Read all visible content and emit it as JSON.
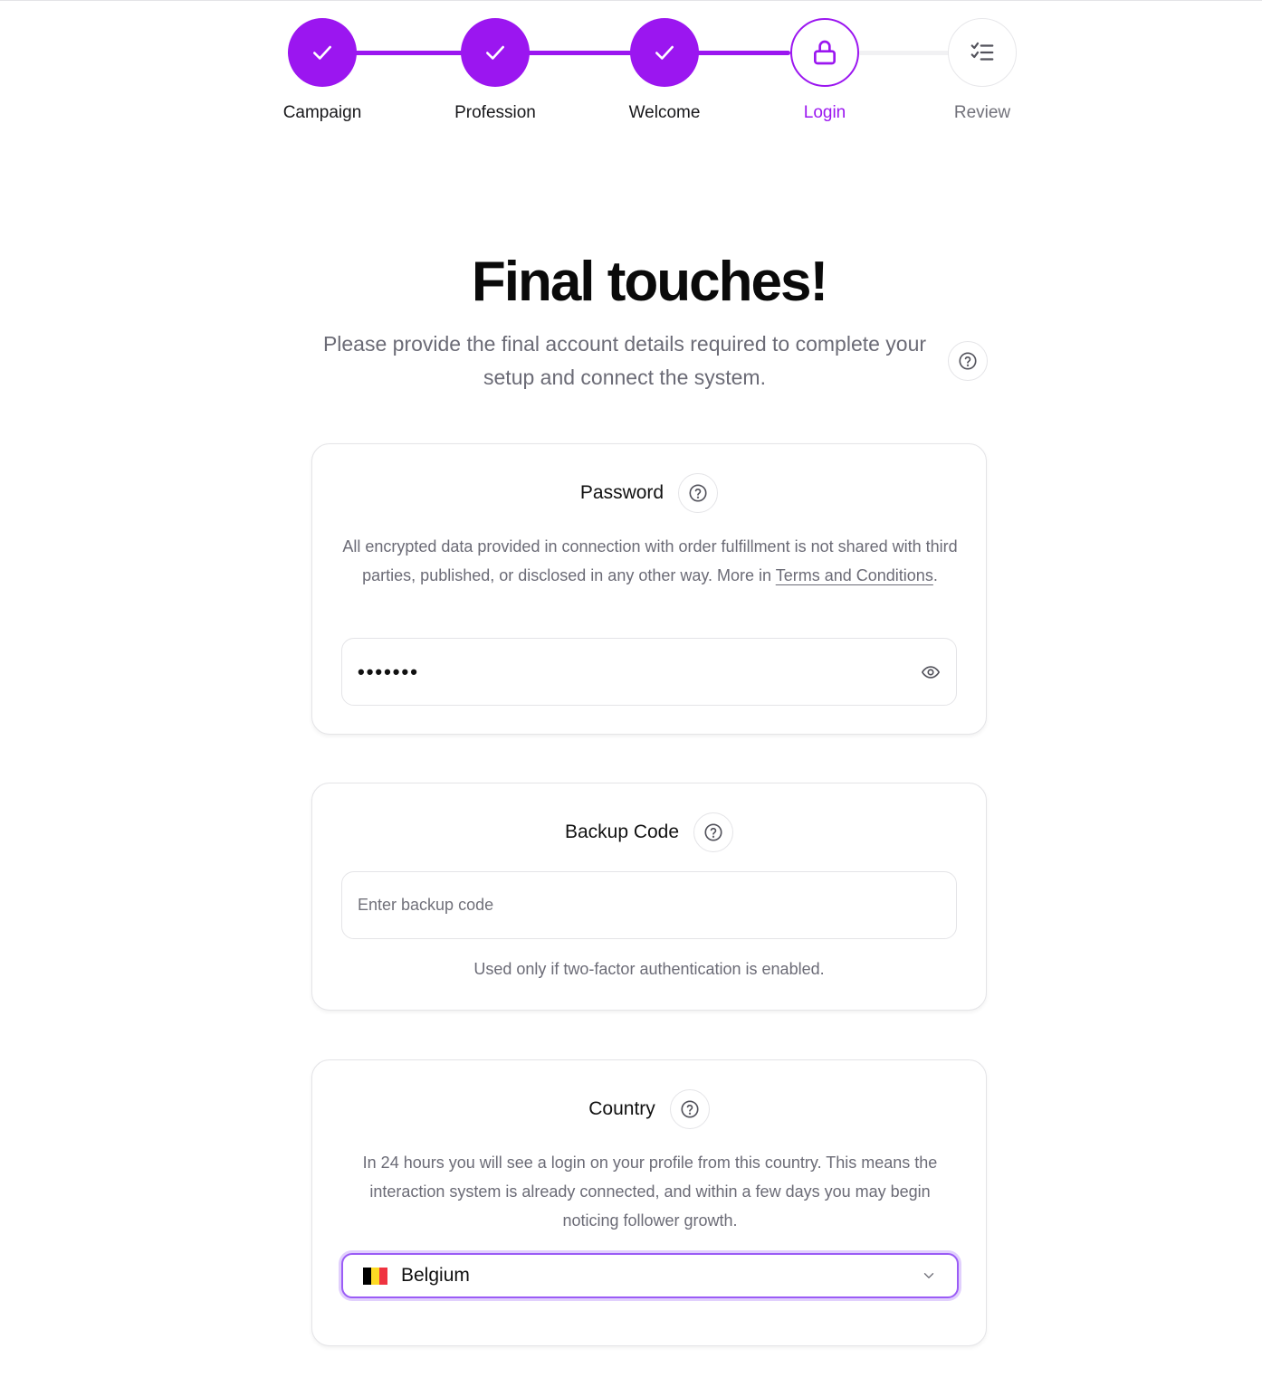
{
  "stepper": {
    "steps": [
      {
        "label": "Campaign",
        "state": "done",
        "icon": "check-icon"
      },
      {
        "label": "Profession",
        "state": "done",
        "icon": "check-icon"
      },
      {
        "label": "Welcome",
        "state": "done",
        "icon": "check-icon"
      },
      {
        "label": "Login",
        "state": "active",
        "icon": "lock-icon"
      },
      {
        "label": "Review",
        "state": "pending",
        "icon": "checklist-icon"
      }
    ]
  },
  "header": {
    "title": "Final touches!",
    "subtitle": "Please provide the final account details required to complete your setup and connect the system."
  },
  "password_card": {
    "title": "Password",
    "description": "All encrypted data provided in connection with order fulfillment is not shared with third parties, published, or disclosed in any other way. More in ",
    "link_text": "Terms and Conditions",
    "description_end": ".",
    "value_masked": "•••••••",
    "toggle_icon": "eye-icon"
  },
  "backup_card": {
    "title": "Backup Code",
    "placeholder": "Enter backup code",
    "note": "Used only if two-factor authentication is enabled."
  },
  "country_card": {
    "title": "Country",
    "description": "In 24 hours you will see a login on your profile from this country. This means the interaction system is already connected, and within a few days you may begin noticing follower growth.",
    "selected": "Belgium",
    "flag_colors": [
      "#000000",
      "#FDDA24",
      "#EF3340"
    ]
  },
  "colors": {
    "accent": "#9B16F0",
    "muted_text": "#6B6B76",
    "border": "#E4E4E7"
  }
}
